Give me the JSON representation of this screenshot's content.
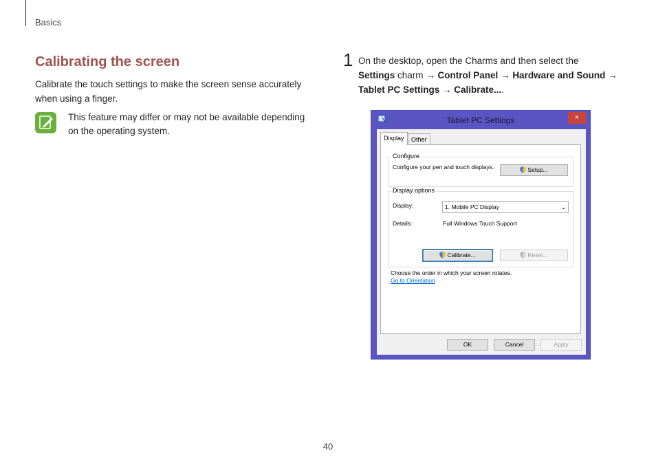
{
  "header": {
    "section": "Basics"
  },
  "section_title": "Calibrating the screen",
  "intro": "Calibrate the touch settings to make the screen sense accurately when using a finger.",
  "note": {
    "icon": "note-pen-icon",
    "text": "This feature may differ or may not be available depending on the operating system."
  },
  "step": {
    "number": "1",
    "text_1": "On the desktop, open the Charms and then select the",
    "settings": "Settings",
    "charm": " charm → ",
    "control_panel": "Control Panel",
    "arrow1": " → ",
    "hardware": "Hardware and Sound",
    "arrow2": " →",
    "tablet": "Tablet PC Settings",
    "arrow3": " → ",
    "calibrate": "Calibrate...",
    "period": "."
  },
  "dialog": {
    "title": "Tablet PC Settings",
    "close": "×",
    "tabs": [
      "Display",
      "Other"
    ],
    "configure": {
      "label": "Configure",
      "description": "Configure your pen and touch displays.",
      "setup_button": "Setup..."
    },
    "display_options": {
      "label": "Display options",
      "display_label": "Display:",
      "display_value": "1. Mobile PC Display",
      "details_label": "Details:",
      "details_value": "Full Windows Touch Support",
      "calibrate_button": "Calibrate...",
      "reset_button": "Reset..."
    },
    "orientation_text": "Choose the order in which your screen rotates.",
    "orientation_link": "Go to Orientation",
    "ok_button": "OK",
    "cancel_button": "Cancel",
    "apply_button": "Apply"
  },
  "page_number": "40",
  "colors": {
    "title": "#a0524f",
    "note_icon": "#6ab03c",
    "dialog_frame": "#5b55c4",
    "close": "#c7453b"
  }
}
